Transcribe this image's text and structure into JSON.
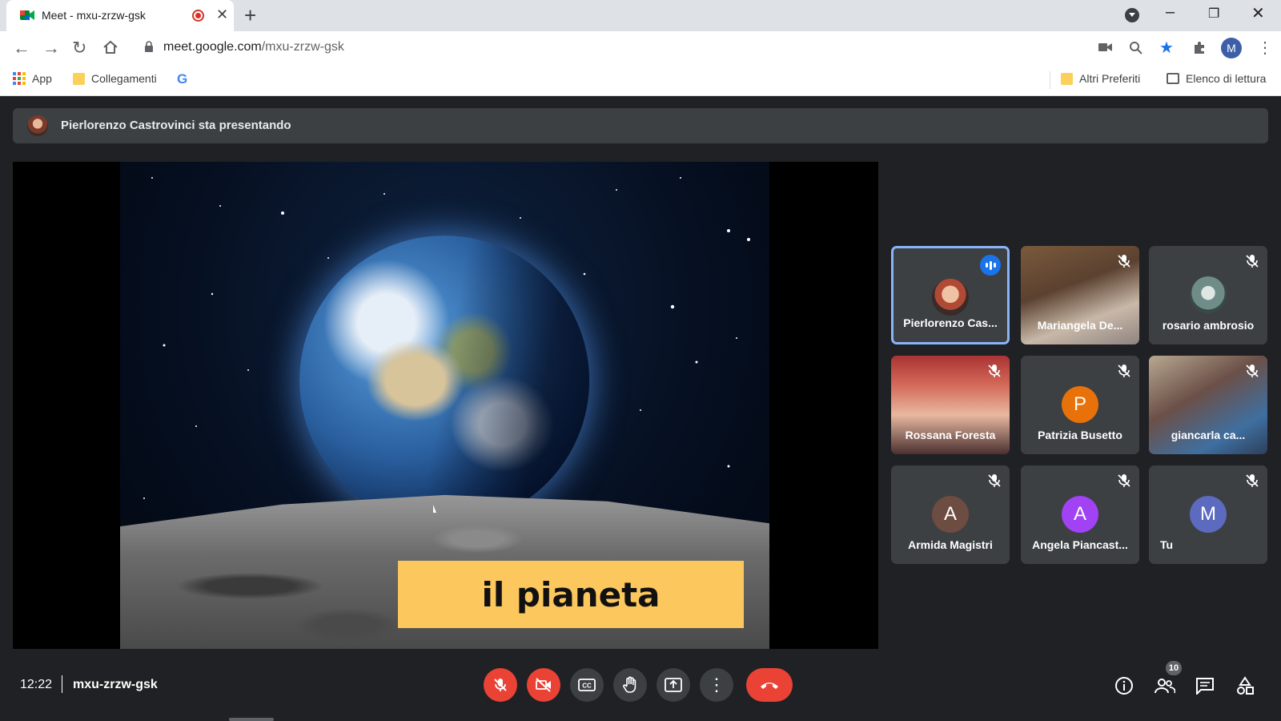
{
  "browser": {
    "tab_title": "Meet - mxu-zrzw-gsk",
    "url_host": "meet.google.com",
    "url_path": "/mxu-zrzw-gsk",
    "profile_initial": "M",
    "bookmarks": {
      "apps": "App",
      "folder": "Collegamenti",
      "google": "G",
      "other": "Altri Preferiti",
      "reading_list": "Elenco di lettura"
    }
  },
  "meet": {
    "presenting_text": "Pierlorenzo Castrovinci sta presentando",
    "slide_caption": "il pianeta",
    "participants": [
      {
        "name": "Pierlorenzo Cas...",
        "kind": "photo",
        "speaking": true,
        "muted": false
      },
      {
        "name": "Mariangela De...",
        "kind": "video",
        "muted": true
      },
      {
        "name": "rosario ambrosio",
        "kind": "photo",
        "muted": true
      },
      {
        "name": "Rossana Foresta",
        "kind": "video",
        "muted": true
      },
      {
        "name": "Patrizia Busetto",
        "kind": "letter",
        "initial": "P",
        "color": "#e8710a",
        "muted": true
      },
      {
        "name": "giancarla ca...",
        "kind": "video",
        "muted": true
      },
      {
        "name": "Armida Magistri",
        "kind": "letter",
        "initial": "A",
        "color": "#6d4c41",
        "muted": true
      },
      {
        "name": "Angela Piancast...",
        "kind": "letter",
        "initial": "A",
        "color": "#a142f4",
        "muted": true
      },
      {
        "name": "Tu",
        "kind": "letter",
        "initial": "M",
        "color": "#5c6bc0",
        "muted": true
      }
    ],
    "clock": "12:22",
    "meeting_code": "mxu-zrzw-gsk",
    "participant_count": "10",
    "colors": {
      "hangup": "#ea4335",
      "active_border": "#8ab4f8",
      "bg": "#202124"
    }
  }
}
